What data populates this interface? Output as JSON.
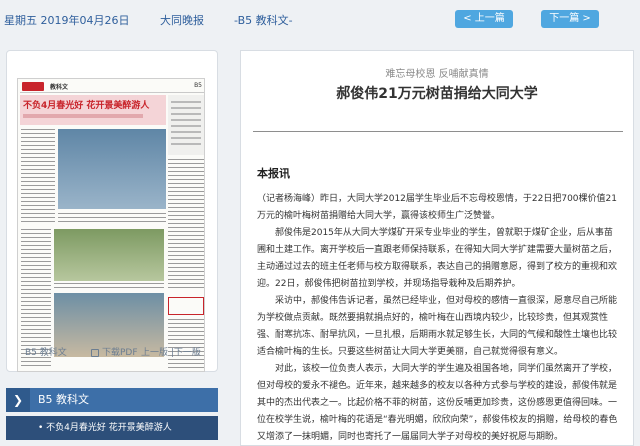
{
  "topbar": {
    "date": "星期五 2019年04月26日",
    "paper": "大同晚报",
    "section": "-B5 教科文-",
    "prev_label": "< 上一篇",
    "next_label": "下一篇 >"
  },
  "thumbnail": {
    "section_label": "教科文",
    "page_label": "B5",
    "headline": "不负4月春光好  花开景美醉游人"
  },
  "left_footer": {
    "edition": "B5 教科文",
    "download": "下载PDF",
    "page_nav": "上一版 |下一版"
  },
  "section_list": {
    "header": "B5 教科文",
    "items": [
      "• 不负4月春光好 花开景美醉游人"
    ]
  },
  "article": {
    "kicker": "难忘母校恩 反哺献真情",
    "title": "郝俊伟21万元树苗捐给大同大学",
    "byline": "本报讯",
    "paragraphs": [
      "（记者杨海峰）昨日，大同大学2012届学生毕业后不忘母校恩情，于22日把700棵价值21万元的榆叶梅树苗捐赠给大同大学，赢得该校师生广泛赞誉。",
      "郝俊伟是2015年从大同大学煤矿开采专业毕业的学生，曾就职于煤矿企业，后从事苗圃和土建工作。离开学校后一直跟老师保持联系，在得知大同大学扩建需要大量树苗之后，主动通过过去的班主任老师与校方取得联系，表达自己的捐赠意愿，得到了校方的重视和欢迎。22日，郝俊伟把树苗拉到学校，并现场指导栽种及后期养护。",
      "采访中，郝俊伟告诉记者，虽然已经毕业，但对母校的感情一直很深，愿意尽自己所能为学校做点贡献。既然要捐就捐点好的，榆叶梅在山西境内较少，比较珍贵，但其观赏性强、耐寒抗冻、耐旱抗风，一旦扎根，后期雨水就足够生长，大同的气候和酸性土壤也比较适合榆叶梅的生长。只要这些树苗让大同大学更美丽，自己就觉得很有意义。",
      "对此，该校一位负责人表示，大同大学的学生遍及祖国各地，同学们虽然离开了学校，但对母校的爱永不褪色。近年来，越来越多的校友以各种方式参与学校的建设，郝俊伟就是其中的杰出代表之一。比起价格不菲的树苗，这份反哺更加珍贵，这份感恩更值得回味。一位在校学生说，榆叶梅的花语是“春光明媚，欣欣向荣”，郝俊伟校友的捐赠，给母校的春色又增添了一抹明媚，同时也寄托了一届届同大学子对母校的美好祝愿与期盼。"
    ]
  },
  "colors": {
    "accent": "#4fa7e0",
    "section_header": "#3d6fa8",
    "section_item": "#2d4f7a",
    "nav_text": "#2f5f9c"
  }
}
